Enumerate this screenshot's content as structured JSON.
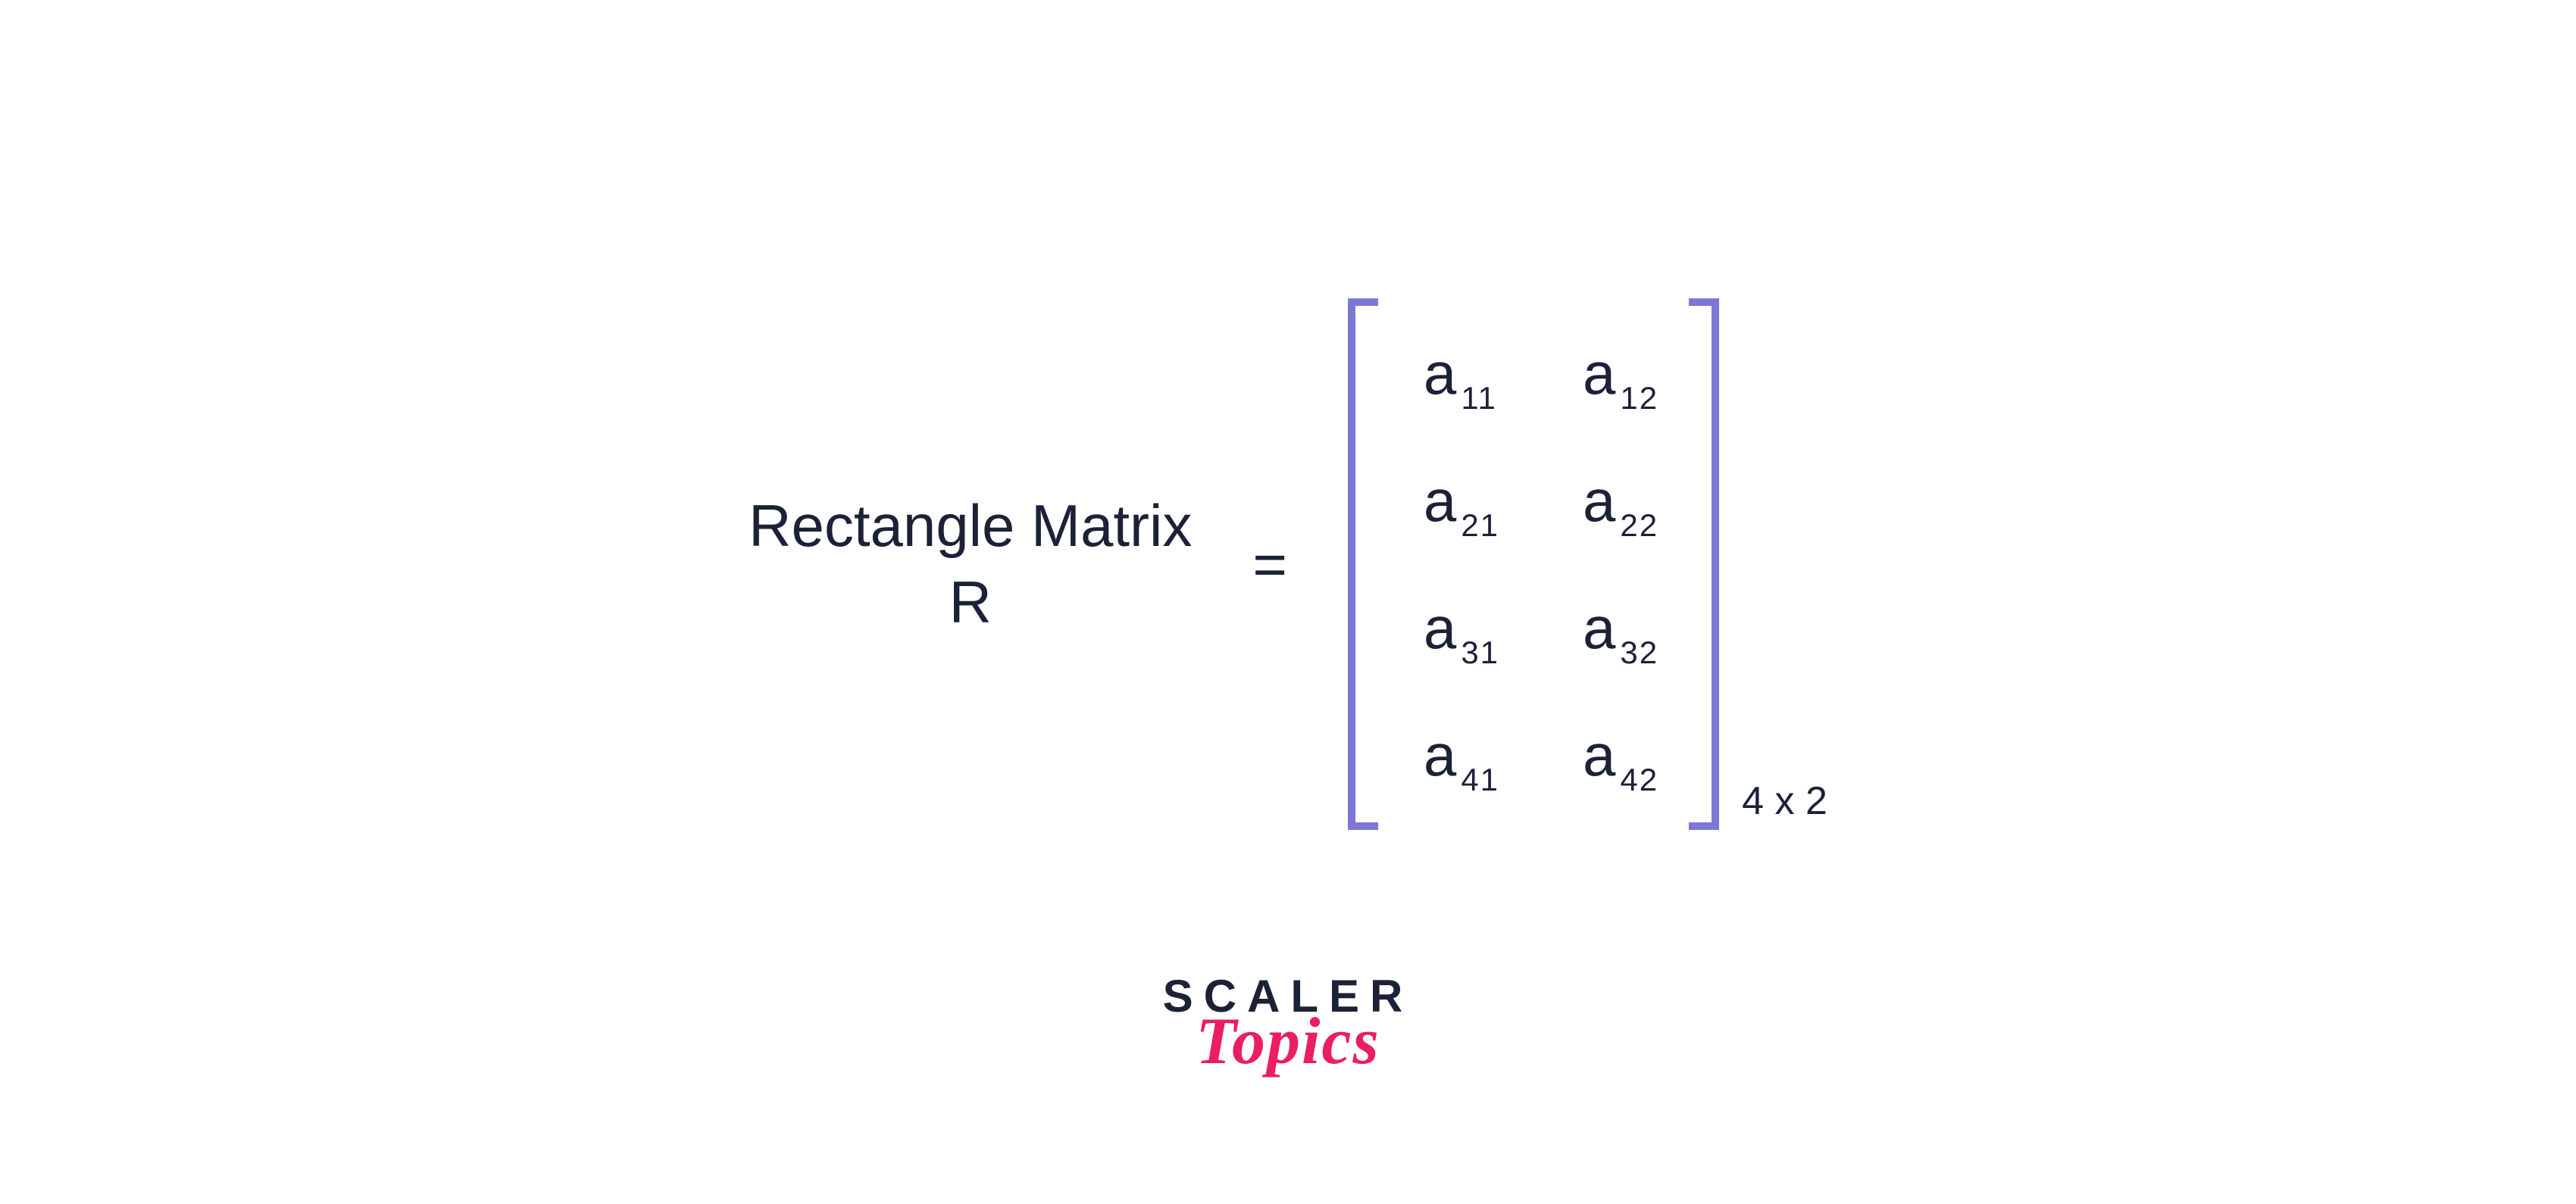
{
  "label": {
    "line1": "Rectangle Matrix",
    "line2": "R"
  },
  "equals": "=",
  "matrix": {
    "variable": "a",
    "rows": [
      [
        {
          "sub": "11"
        },
        {
          "sub": "12"
        }
      ],
      [
        {
          "sub": "21"
        },
        {
          "sub": "22"
        }
      ],
      [
        {
          "sub": "31"
        },
        {
          "sub": "32"
        }
      ],
      [
        {
          "sub": "41"
        },
        {
          "sub": "42"
        }
      ]
    ],
    "dimension": "4 x 2",
    "bracket_color": "#7b78d6"
  },
  "logo": {
    "top": "SCALER",
    "bottom": "Topics"
  },
  "colors": {
    "text": "#1b2238",
    "accent": "#e91e63"
  }
}
